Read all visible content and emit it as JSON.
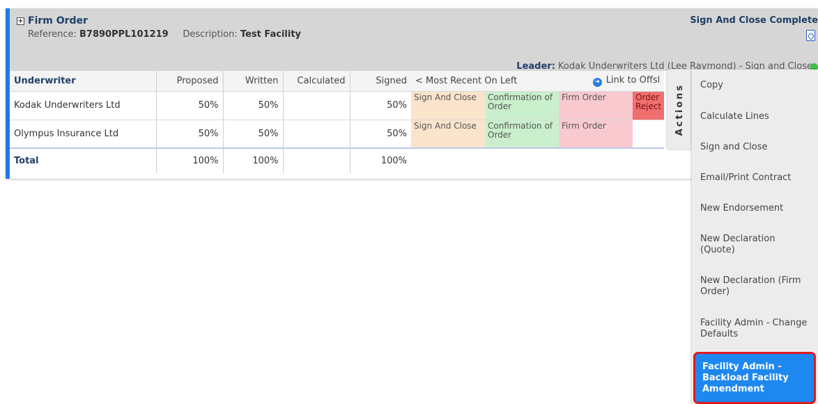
{
  "header": {
    "expand_symbol": "+",
    "title": "Firm Order",
    "reference_label": "Reference:",
    "reference_value": "B7890PPL101219",
    "description_label": "Description:",
    "description_value": "Test Facility",
    "status": "Sign And Close Complete",
    "leader_label": "Leader:",
    "leader_value": "Kodak Underwriters Ltd (Lee Raymond) - Sign and Close",
    "status_color": "#39c23c",
    "pdf_icon": "pdf-icon"
  },
  "table": {
    "columns": [
      "Underwriter",
      "Proposed",
      "Written",
      "Calculated",
      "Signed"
    ],
    "recent_label": "< Most Recent On Left",
    "link_label": "Link to Offsl",
    "link_icon": "arrow-circle-icon",
    "rows": [
      {
        "underwriter": "Kodak Underwriters Ltd",
        "proposed": "50%",
        "written": "50%",
        "calculated": "",
        "signed": "50%",
        "stages": [
          "Sign And Close",
          "Confirmation of Order",
          "Firm Order",
          "Order Reject"
        ]
      },
      {
        "underwriter": "Olympus Insurance Ltd",
        "proposed": "50%",
        "written": "50%",
        "calculated": "",
        "signed": "50%",
        "stages": [
          "Sign And Close",
          "Confirmation of Order",
          "Firm Order",
          ""
        ]
      }
    ],
    "total": {
      "label": "Total",
      "proposed": "100%",
      "written": "100%",
      "calculated": "",
      "signed": "100%"
    },
    "stage_colors": {
      "sign": "#fbe4cc",
      "confirmation": "#c9efcc",
      "firm": "#f9c9d0",
      "reject": "#ef6f6f"
    }
  },
  "actions": {
    "tab_label": "Actions",
    "items": [
      "Copy",
      "Calculate Lines",
      "Sign and Close",
      "Email/Print Contract",
      "New Endorsement",
      "New Declaration (Quote)",
      "New Declaration (Firm Order)",
      "Facility Admin - Change Defaults",
      "Facility Admin - Backload Facility Amendment"
    ],
    "selected_index": 8,
    "selected_color": "#1e88f0",
    "highlight_color": "#e01b1b"
  }
}
